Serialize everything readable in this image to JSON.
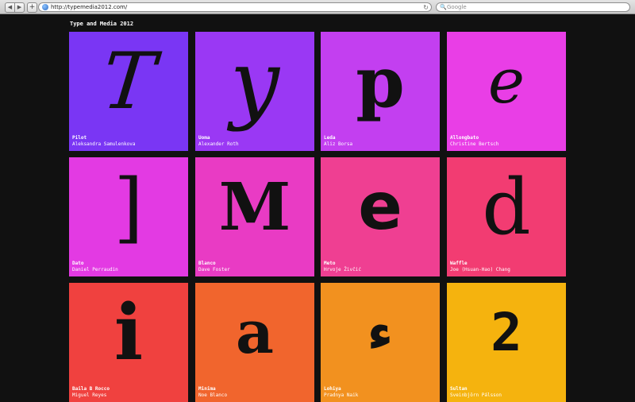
{
  "browser": {
    "url": "http://typemedia2012.com/",
    "search_placeholder": "Google",
    "back_glyph": "◀",
    "forward_glyph": "▶",
    "add_glyph": "+",
    "reload_glyph": "↻",
    "search_glyph": "🔍"
  },
  "page": {
    "title": "Type and Media 2012"
  },
  "tiles": [
    {
      "glyph": "T",
      "name": "Pilot",
      "author": "Aleksandra Samulenkova",
      "color": "#7a36f4"
    },
    {
      "glyph": "y",
      "name": "Uoma",
      "author": "Alexander Roth",
      "color": "#9a38f4"
    },
    {
      "glyph": "p",
      "name": "Leda",
      "author": "Aliz Borsa",
      "color": "#c33ff0"
    },
    {
      "glyph": "e",
      "name": "Allongbato",
      "author": "Christine Bertsch",
      "color": "#e93ee6"
    },
    {
      "glyph": "]",
      "name": "Dato",
      "author": "Daniel Perraudin",
      "color": "#e33ae3"
    },
    {
      "glyph": "M",
      "name": "Blanco",
      "author": "Dave Foster",
      "color": "#e93bc4"
    },
    {
      "glyph": "e",
      "name": "Meto",
      "author": "Hrvoje Živčić",
      "color": "#ef3f92"
    },
    {
      "glyph": "d",
      "name": "Waffle",
      "author": "Joe (Hsuan-Hao) Chang",
      "color": "#f23c72"
    },
    {
      "glyph": "i",
      "name": "Baila B Rocco",
      "author": "Miguel Reyes",
      "color": "#f0413f"
    },
    {
      "glyph": "a",
      "name": "Minima",
      "author": "Noe Blanco",
      "color": "#f1652d"
    },
    {
      "glyph": "ء",
      "name": "Lohiya",
      "author": "Pradnya Naik",
      "color": "#f2911f"
    },
    {
      "glyph": "2",
      "name": "Sultan",
      "author": "Sveinbjörn Pálsson",
      "color": "#f5b30e"
    }
  ]
}
